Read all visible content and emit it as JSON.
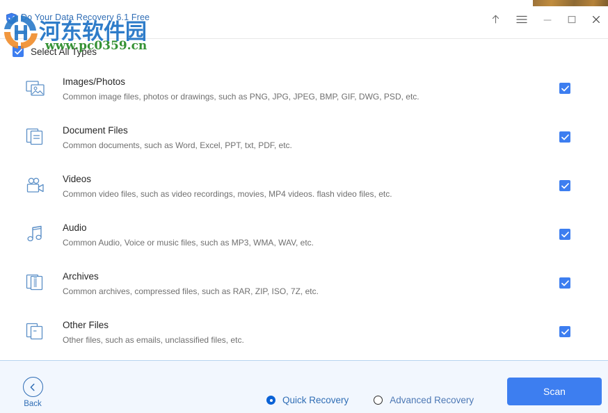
{
  "window": {
    "title": "Do Your Data Recovery 6.1 Free",
    "app_icon": "shield-icon",
    "controls": [
      {
        "name": "upgrade-arrow-icon",
        "label": "↑"
      },
      {
        "name": "menu-icon",
        "label": "☰"
      },
      {
        "name": "minimize-icon",
        "label": "—"
      },
      {
        "name": "maximize-icon",
        "label": "□"
      },
      {
        "name": "close-icon",
        "label": "✕"
      }
    ]
  },
  "watermark": {
    "chinese": "河东软件园",
    "url": "www.pc0359.cn",
    "chinese_color": "#2878c8",
    "url_color": "#2f8f2f"
  },
  "select_all": {
    "label": "Select All Types",
    "checked": true
  },
  "file_types": [
    {
      "icon": "image-photo-icon",
      "title": "Images/Photos",
      "description": "Common image files, photos or drawings, such as PNG, JPG, JPEG, BMP, GIF, DWG, PSD, etc.",
      "checked": true
    },
    {
      "icon": "document-file-icon",
      "title": "Document Files",
      "description": "Common documents, such as Word, Excel, PPT, txt, PDF, etc.",
      "checked": true
    },
    {
      "icon": "video-camera-icon",
      "title": "Videos",
      "description": "Common video files, such as video recordings, movies, MP4 videos. flash video files, etc.",
      "checked": true
    },
    {
      "icon": "music-note-icon",
      "title": "Audio",
      "description": "Common Audio, Voice or music files, such as MP3, WMA, WAV, etc.",
      "checked": true
    },
    {
      "icon": "archive-zip-icon",
      "title": "Archives",
      "description": "Common archives, compressed files, such as RAR, ZIP, ISO, 7Z, etc.",
      "checked": true
    },
    {
      "icon": "other-files-icon",
      "title": "Other Files",
      "description": "Other files, such as emails, unclassified files, etc.",
      "checked": true
    }
  ],
  "footer": {
    "back_label": "Back",
    "back_icon": "chevron-left-icon",
    "recovery_modes": [
      {
        "label": "Quick Recovery",
        "selected": true
      },
      {
        "label": "Advanced Recovery",
        "selected": false
      }
    ],
    "scan_label": "Scan"
  },
  "colors": {
    "accent": "#3d7ef0",
    "link": "#2f6db5",
    "icon": "#5b8fc7",
    "footer_bg": "#f2f7fe"
  }
}
